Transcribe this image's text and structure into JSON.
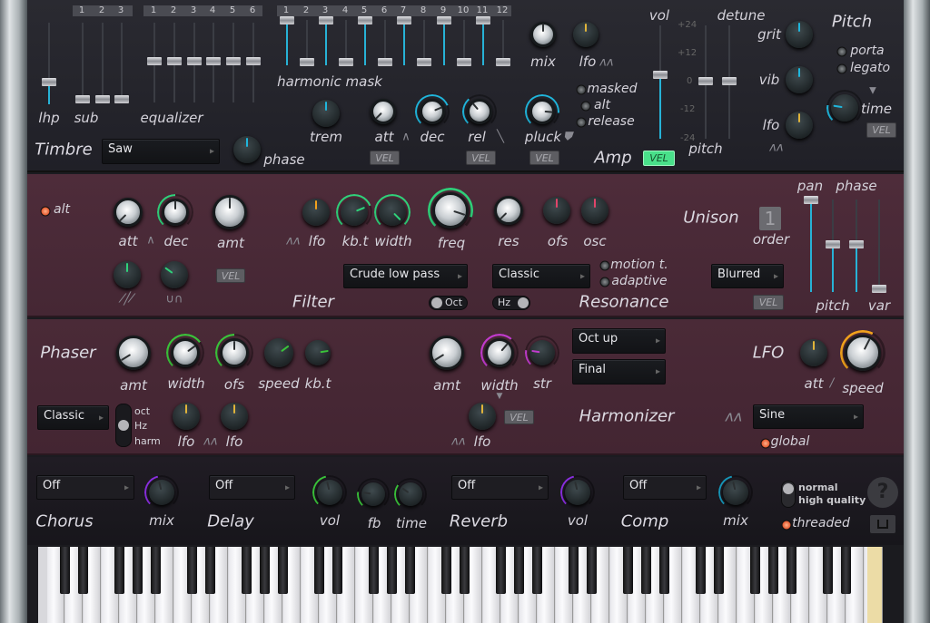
{
  "colors": {
    "cyan": "#1fb6dc",
    "green": "#2fd17a",
    "lime": "#3ac43a",
    "magenta": "#c23bcf",
    "purple": "#8a2ee0",
    "orange": "#f2a21c",
    "teal": "#1796b8",
    "yellow": "#e0b43a",
    "red": "#e0456a",
    "vel_on": "#49e08a",
    "panel_dark": "#25252c",
    "panel_maroon": "#4a2b37"
  },
  "timbre": {
    "title": "Timbre",
    "waveform": "Saw",
    "phase_label": "phase",
    "lhp_label": "lhp",
    "sub_label": "sub",
    "eq_label": "equalizer",
    "mask_label": "harmonic mask",
    "sub_numbers": [
      "1",
      "2",
      "3"
    ],
    "eq_numbers": [
      "1",
      "2",
      "3",
      "4",
      "5",
      "6"
    ],
    "mask_numbers": [
      "1",
      "2",
      "3",
      "4",
      "5",
      "6",
      "7",
      "8",
      "9",
      "10",
      "11",
      "12"
    ],
    "lhp": 0.25,
    "sub": [
      0,
      0,
      0
    ],
    "eq": [
      0.5,
      0.5,
      0.5,
      0.5,
      0.5,
      0.5
    ],
    "mask": [
      1,
      0,
      1,
      0,
      1,
      0,
      1,
      0,
      1,
      0,
      1,
      0
    ],
    "phase": 0.5,
    "trem": 0.5
  },
  "amp": {
    "title": "Amp",
    "mix_label": "mix",
    "lfo_label": "lfo",
    "trem_label": "trem",
    "att_label": "att",
    "dec_label": "dec",
    "rel_label": "rel",
    "pluck_label": "pluck",
    "vel": "VEL",
    "vel_active": "VEL",
    "masked": "masked",
    "alt": "alt",
    "release": "release",
    "mix": 0.5,
    "lfo": 0.5,
    "att": 0.0,
    "dec": 0.75,
    "rel": 0.35,
    "pluck": 0.85,
    "vol": 0.55,
    "vol_label": "vol"
  },
  "pitch": {
    "title": "Pitch",
    "pitch_label": "pitch",
    "detune_label": "detune",
    "scale": [
      "+24",
      "+12",
      "0",
      "-12",
      "-24"
    ],
    "pitch": 0.5,
    "detune": 0.5,
    "grit_label": "grit",
    "vib_label": "vib",
    "lfo_label": "lfo",
    "grit": 0.5,
    "vib": 0.5,
    "lfo": 0.5,
    "porta": "porta",
    "legato": "legato",
    "time_label": "time",
    "time": 0.2,
    "vel": "VEL"
  },
  "filter": {
    "title": "Filter",
    "alt": "alt",
    "att_label": "att",
    "dec_label": "dec",
    "amt_label": "amt",
    "vel": "VEL",
    "att": 0.0,
    "dec": 0.5,
    "amt": 0.5,
    "shape1": 0.5,
    "shape2": 0.3,
    "lfo_label": "lfo",
    "kbt_label": "kb.t",
    "width_label": "width",
    "freq_label": "freq",
    "lfo": 0.5,
    "kbt": 0.75,
    "width": 1.0,
    "freq": 0.9,
    "type": "Crude low pass",
    "oct": "Oct"
  },
  "resonance": {
    "title": "Resonance",
    "res_label": "res",
    "ofs_label": "ofs",
    "osc_label": "osc",
    "res": 0.0,
    "ofs": 0.5,
    "osc": 0.5,
    "mode": "Classic",
    "hz": "Hz",
    "motion": "motion t.",
    "adaptive": "adaptive"
  },
  "unison": {
    "title": "Unison",
    "order": "1",
    "order_label": "order",
    "mode": "Blurred",
    "vel": "VEL",
    "pan_label": "pan",
    "phase_label": "phase",
    "pitch_label": "pitch",
    "var_label": "var",
    "pan": 1.0,
    "pitch": 0.5,
    "phase": 0.5,
    "var": 0.0
  },
  "phaser": {
    "title": "Phaser",
    "amt_label": "amt",
    "width_label": "width",
    "ofs_label": "ofs",
    "speed_label": "speed",
    "kbt_label": "kb.t",
    "amt": 0.05,
    "width": 0.7,
    "ofs": 0.5,
    "speed": 0.7,
    "kbt": 0.8,
    "mode": "Classic",
    "opts": [
      "oct",
      "Hz",
      "harm"
    ],
    "lfo_label": "lfo",
    "lfo1": 0.5,
    "lfo2": 0.5
  },
  "harmonizer": {
    "title": "Harmonizer",
    "amt_label": "amt",
    "width_label": "width",
    "str_label": "str",
    "amt": 0.05,
    "width": 0.65,
    "str": 0.2,
    "lfo_label": "lfo",
    "lfo": 0.5,
    "vel": "VEL",
    "mode1": "Oct up",
    "mode2": "Final"
  },
  "lfo": {
    "title": "LFO",
    "att_label": "att",
    "speed_label": "speed",
    "att": 0.5,
    "speed": 0.6,
    "shape": "Sine",
    "global": "global"
  },
  "fx": {
    "chorus": {
      "title": "Chorus",
      "mode": "Off",
      "mix_label": "mix",
      "mix": 0.45
    },
    "delay": {
      "title": "Delay",
      "mode": "Off",
      "vol_label": "vol",
      "fb_label": "fb",
      "time_label": "time",
      "vol": 0.45,
      "fb": 0.2,
      "time": 0.3
    },
    "reverb": {
      "title": "Reverb",
      "mode": "Off",
      "vol_label": "vol",
      "vol": 0.45
    },
    "comp": {
      "title": "Comp",
      "mode": "Off",
      "mix_label": "mix",
      "mix": 0.45
    },
    "quality": [
      "normal",
      "high quality"
    ],
    "threaded": "threaded",
    "help": "?"
  }
}
